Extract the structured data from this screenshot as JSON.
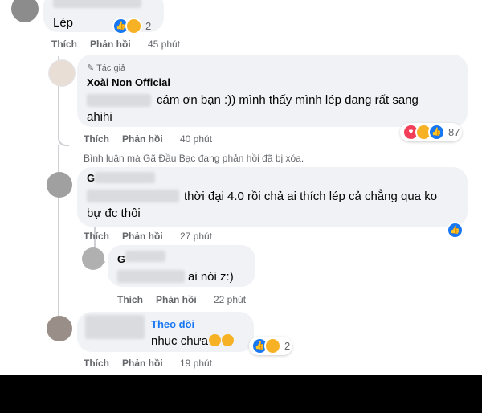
{
  "comment1": {
    "text": "Lép",
    "reaction_count": "2",
    "actions": {
      "like": "Thích",
      "reply": "Phản hồi",
      "time": "45 phút"
    }
  },
  "comment2": {
    "author_badge": "Tác giả",
    "author_name": "Xoài Non Official",
    "text_line1": "cám ơn bạn :)) mình thấy mình lép đang rất sang",
    "text_line2": "ahihi",
    "reaction_count": "87",
    "actions": {
      "like": "Thích",
      "reply": "Phản hồi",
      "time": "40 phút"
    }
  },
  "deleted_notice": "Bình luận mà Gã Đầu Bạc đang phản hồi đã bị xóa.",
  "comment3": {
    "author_initial": "G",
    "text_line1": "thời đại 4.0 rồi chả ai thích lép cả chẳng qua ko",
    "text_line2": "bự đc thôi",
    "actions": {
      "like": "Thích",
      "reply": "Phản hồi",
      "time": "27 phút"
    }
  },
  "comment4": {
    "author_initial": "G",
    "text": "ai nói z:)",
    "actions": {
      "like": "Thích",
      "reply": "Phản hồi",
      "time": "22 phút"
    }
  },
  "comment5": {
    "follow_label": "Theo dõi",
    "text": "nhục chưa",
    "reaction_count": "2",
    "actions": {
      "like": "Thích",
      "reply": "Phản hồi",
      "time": "19 phút"
    }
  },
  "colors": {
    "link_blue": "#1877f2",
    "meta_gray": "#65676b",
    "bubble": "#f0f2f5"
  }
}
